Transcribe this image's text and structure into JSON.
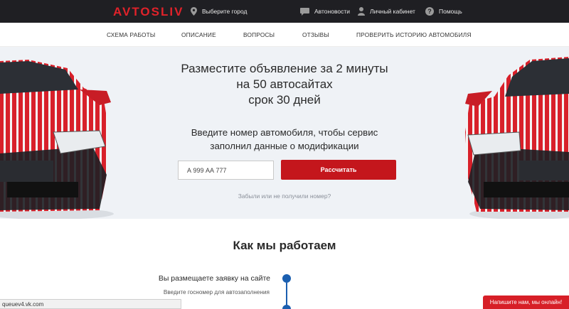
{
  "header": {
    "logo": "AVTOSLIV",
    "city": "Выберите город",
    "news": "Автоновости",
    "cabinet": "Личный кабинет",
    "help": "Помощь"
  },
  "nav": {
    "items": [
      "СХЕМА РАБОТЫ",
      "ОПИСАНИЕ",
      "ВОПРОСЫ",
      "ОТЗЫВЫ",
      "ПРОВЕРИТЬ ИСТОРИЮ АВТОМОБИЛЯ"
    ]
  },
  "hero": {
    "title_line1": "Разместите объявление за 2 минуты",
    "title_line2": "на 50 автосайтах",
    "title_line3": "срок 30 дней",
    "subtitle_line1": "Введите номер автомобиля, чтобы сервис",
    "subtitle_line2": "заполнил данные о модификации",
    "plate_value": "А 999 АА 777",
    "calc_button": "Рассчитать",
    "forgot_link": "Забыли или не получили номер?"
  },
  "how": {
    "title": "Как мы работаем",
    "step1_title": "Вы размещаете заявку на сайте",
    "step1_sub": "Введите госномер для автозаполнения"
  },
  "statusbar": {
    "url": "queuev4.vk.com"
  },
  "chat": {
    "label": "Напишите нам, мы онлайн!"
  },
  "colors": {
    "brand_red": "#c4161c",
    "topbar_bg": "#1f1f23",
    "accent_blue": "#1b5fb0",
    "hero_bg": "#eff2f6"
  }
}
